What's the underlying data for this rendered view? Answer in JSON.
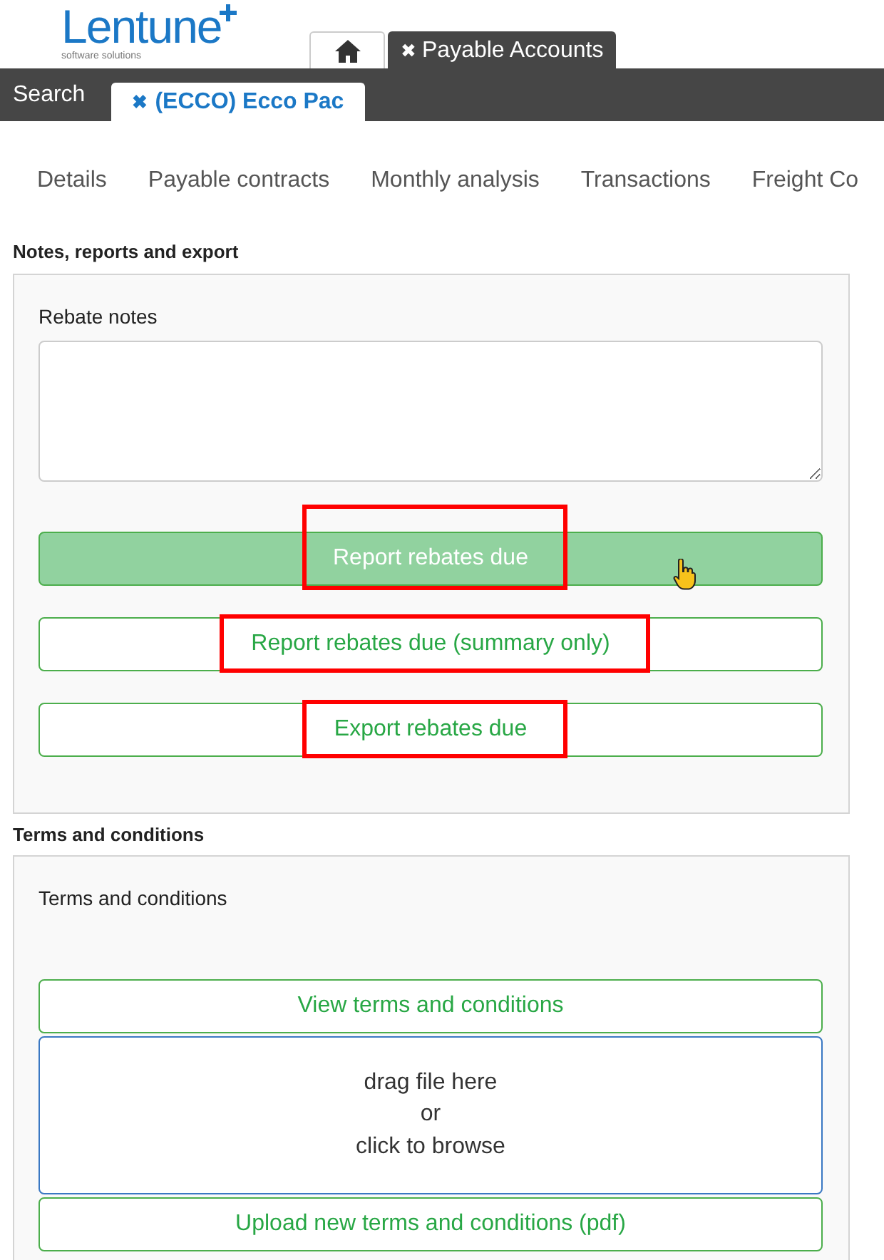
{
  "logo": {
    "name": "Lentune",
    "tagline": "software solutions"
  },
  "app_tabs": [
    {
      "kind": "home",
      "selected": false
    },
    {
      "kind": "text",
      "close": "✖",
      "label": "Payable Accounts",
      "selected": true
    }
  ],
  "record_bar": {
    "search": "Search",
    "tabs": [
      {
        "close": "✖",
        "label": "(ECCO) Ecco Pac",
        "selected": true
      }
    ]
  },
  "sub_nav": [
    {
      "label": "Details"
    },
    {
      "label": "Payable contracts"
    },
    {
      "label": "Monthly analysis"
    },
    {
      "label": "Transactions"
    },
    {
      "label": "Freight Co"
    }
  ],
  "sections": [
    {
      "heading": "Notes, reports and export",
      "items": [
        {
          "kind": "label",
          "text": "Rebate notes"
        },
        {
          "kind": "textarea"
        },
        {
          "kind": "button",
          "label": "Report rebates due",
          "hovered": true,
          "highlighted": true
        },
        {
          "kind": "button",
          "label": "Report rebates due (summary only)",
          "hovered": false,
          "highlighted": true
        },
        {
          "kind": "button",
          "label": "Export rebates due",
          "hovered": false,
          "highlighted": true
        }
      ]
    },
    {
      "heading": "Terms and conditions",
      "items": [
        {
          "kind": "label",
          "text": "Terms and conditions"
        },
        {
          "kind": "button",
          "label": "View terms and conditions",
          "hovered": false,
          "highlighted": false
        },
        {
          "kind": "dropzone",
          "lines": [
            "drag file here",
            "or",
            "click to browse"
          ]
        },
        {
          "kind": "button",
          "label": "Upload new terms and conditions (pdf)",
          "hovered": false,
          "highlighted": false
        }
      ]
    }
  ]
}
